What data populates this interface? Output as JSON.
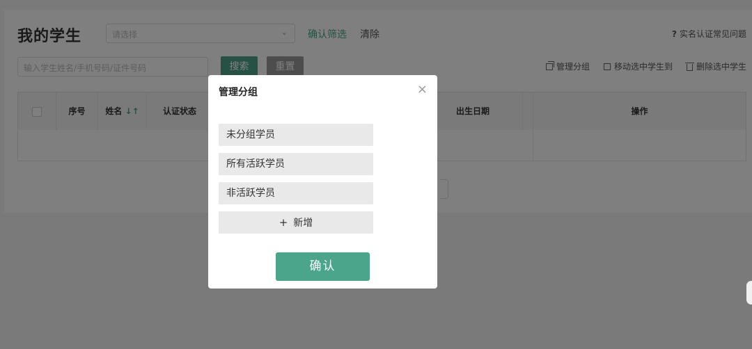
{
  "page": {
    "title": "我的学生",
    "filter_select_placeholder": "请选择",
    "confirm_filter_label": "确认筛选",
    "clear_label": "清除",
    "faq_label": "实名认证常见问题",
    "search_placeholder": "输入学生姓名/手机号码/证件号码",
    "search_button": "搜索",
    "reset_button": "重置",
    "actions": [
      {
        "label": "管理分组",
        "icon": "copy-icon"
      },
      {
        "label": "移动选中学生到",
        "icon": "move-icon"
      },
      {
        "label": "删除选中学生",
        "icon": "trash-icon"
      }
    ]
  },
  "table": {
    "columns": [
      "序号",
      "姓名",
      "认证状态",
      "出生日期",
      "操作"
    ],
    "name_sort_icon": "↓↑"
  },
  "modal": {
    "title": "管理分组",
    "close_icon": "×",
    "groups": [
      "未分组学员",
      "所有活跃学员",
      "非活跃学员"
    ],
    "add_label": "新增",
    "confirm_label": "确认"
  },
  "colors": {
    "accent": "#4aa58a",
    "overlay": "rgba(0,0,0,0.5)"
  }
}
